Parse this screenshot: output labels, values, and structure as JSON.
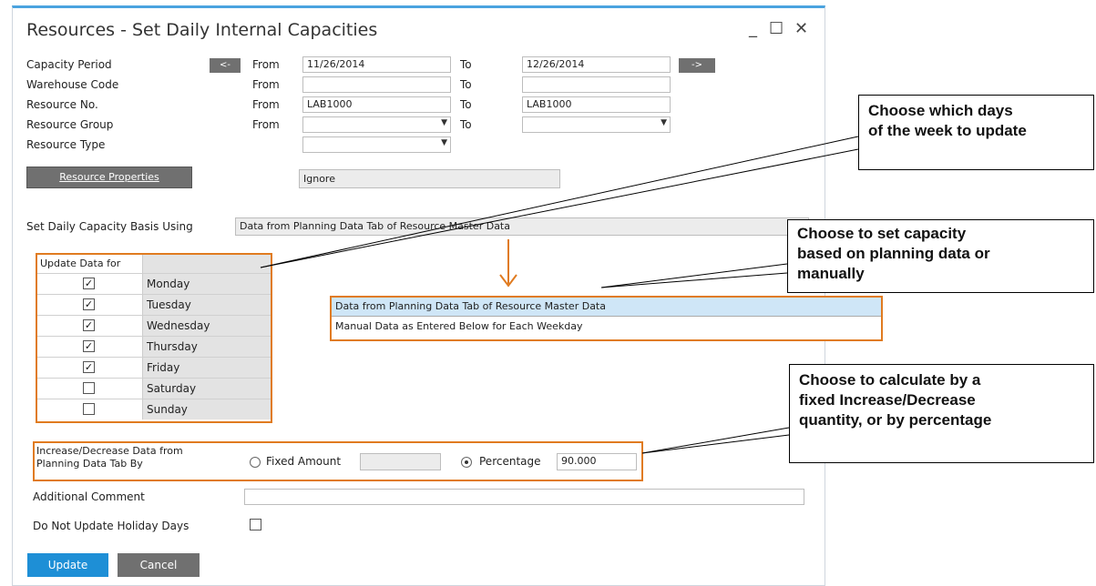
{
  "window": {
    "title": "Resources - Set Daily Internal Capacities"
  },
  "window_controls": {
    "minimize": "_",
    "maximize": "☐",
    "close": "✕"
  },
  "form": {
    "capacity_period": {
      "label": "Capacity Period",
      "prev": "<-",
      "from_label": "From",
      "from_value": "11/26/2014",
      "to_label": "To",
      "to_value": "12/26/2014",
      "next": "->"
    },
    "warehouse_code": {
      "label": "Warehouse Code",
      "from_label": "From",
      "from_value": "",
      "to_label": "To",
      "to_value": ""
    },
    "resource_no": {
      "label": "Resource No.",
      "from_label": "From",
      "from_value": "LAB1000",
      "to_label": "To",
      "to_value": "LAB1000"
    },
    "resource_group": {
      "label": "Resource Group",
      "from_label": "From",
      "from_value": "",
      "to_label": "To",
      "to_value": ""
    },
    "resource_type": {
      "label": "Resource Type",
      "value": ""
    },
    "resource_properties": {
      "button": "Resource Properties",
      "value": "Ignore"
    },
    "basis": {
      "label": "Set Daily Capacity Basis Using",
      "value": "Data from Planning Data Tab of Resource Master Data"
    },
    "basis_options": [
      "Data from Planning Data Tab of Resource Master Data",
      "Manual Data as Entered Below for Each Weekday"
    ],
    "update_grid": {
      "header": "Update Data for",
      "days": [
        {
          "name": "Monday",
          "checked": true,
          "mark": "✓"
        },
        {
          "name": "Tuesday",
          "checked": true,
          "mark": "✓"
        },
        {
          "name": "Wednesday",
          "checked": true,
          "mark": "✓"
        },
        {
          "name": "Thursday",
          "checked": true,
          "mark": "✓"
        },
        {
          "name": "Friday",
          "checked": true,
          "mark": "✓"
        },
        {
          "name": "Saturday",
          "checked": false,
          "mark": ""
        },
        {
          "name": "Sunday",
          "checked": false,
          "mark": ""
        }
      ]
    },
    "increase": {
      "label_line1": "Increase/Decrease Data from",
      "label_line2": "Planning Data Tab By",
      "fixed_label": "Fixed Amount",
      "fixed_value": "",
      "percentage_label": "Percentage",
      "percentage_value": "90.000",
      "selected": "percentage"
    },
    "comment": {
      "label": "Additional Comment",
      "value": ""
    },
    "holiday": {
      "label": "Do Not Update Holiday Days",
      "checked": false
    }
  },
  "buttons": {
    "update": "Update",
    "cancel": "Cancel"
  },
  "callouts": {
    "days": [
      "Choose which days",
      "of the week to update"
    ],
    "basis": [
      "Choose to set capacity",
      "based on planning data or",
      "manually"
    ],
    "calc": [
      "Choose to calculate by a",
      "fixed Increase/Decrease",
      "quantity, or by percentage"
    ]
  },
  "colors": {
    "accent": "#4aa3df",
    "highlight": "#e07b20",
    "update_button": "#1e8fd6",
    "gray_button": "#707070"
  }
}
